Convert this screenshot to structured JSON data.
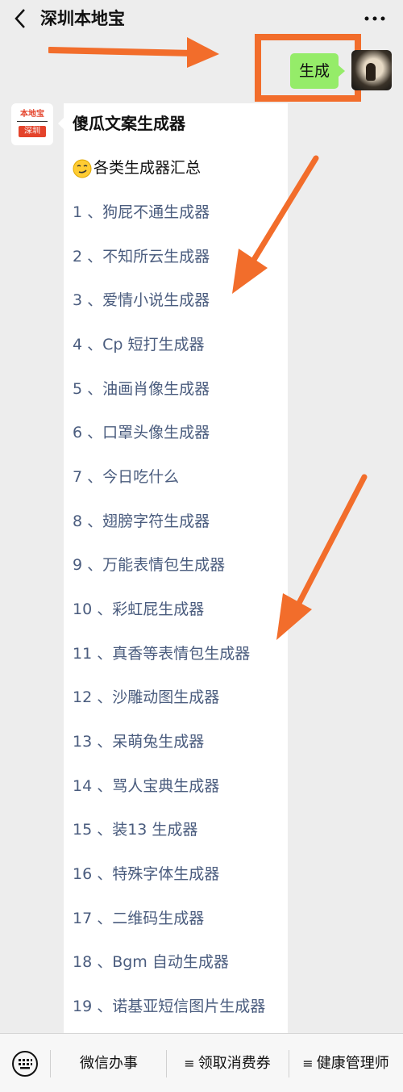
{
  "header": {
    "title": "深圳本地宝",
    "back_icon": "chevron-left-icon",
    "more_icon": "more-dots-icon"
  },
  "user_message": {
    "text": "生成"
  },
  "bot": {
    "avatar": {
      "line1": "本地宝",
      "line3": "深圳"
    },
    "title": "傻瓜文案生成器",
    "subtitle": "各类生成器汇总",
    "items": [
      "1 、狗屁不通生成器",
      "2 、不知所云生成器",
      "3 、爱情小说生成器",
      "4 、Cp 短打生成器",
      "5 、油画肖像生成器",
      "6 、口罩头像生成器",
      "7 、今日吃什么",
      "8 、翅膀字符生成器",
      "9 、万能表情包生成器",
      "10 、彩虹屁生成器",
      "11 、真香等表情包生成器",
      "12 、沙雕动图生成器",
      "13 、呆萌兔生成器",
      "14 、骂人宝典生成器",
      "15 、装13 生成器",
      "16 、特殊字体生成器",
      "17 、二维码生成器",
      "18 、Bgm 自动生成器",
      "19 、诺基亚短信图片生成器"
    ]
  },
  "bottom_menu": {
    "items": [
      {
        "label": "微信办事",
        "prefix": ""
      },
      {
        "label": "领取消费券",
        "prefix": "≡"
      },
      {
        "label": "健康管理师",
        "prefix": "≡"
      }
    ]
  },
  "colors": {
    "accent_arrow": "#f26d2b",
    "bubble_green": "#95ec69",
    "link_text": "#4a5c7e",
    "background": "#ededed"
  }
}
